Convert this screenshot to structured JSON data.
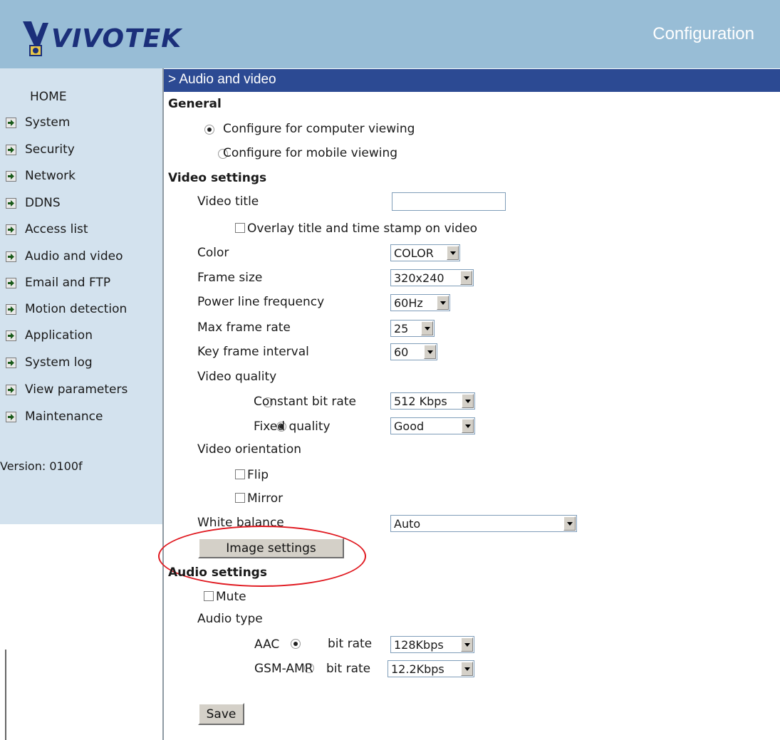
{
  "header": {
    "logo_text": "VIVOTEK",
    "title": "Configuration"
  },
  "breadcrumb": "> Audio and video",
  "sidebar": {
    "home": "HOME",
    "items": [
      {
        "label": "System"
      },
      {
        "label": "Security"
      },
      {
        "label": "Network"
      },
      {
        "label": "DDNS"
      },
      {
        "label": "Access list"
      },
      {
        "label": "Audio and video"
      },
      {
        "label": "Email and FTP"
      },
      {
        "label": "Motion detection"
      },
      {
        "label": "Application"
      },
      {
        "label": "System log"
      },
      {
        "label": "View parameters"
      },
      {
        "label": "Maintenance"
      }
    ],
    "version": "Version: 0100f"
  },
  "general": {
    "heading": "General",
    "computer_viewing": "Configure for computer viewing",
    "mobile_viewing": "Configure for mobile viewing",
    "selected": "computer"
  },
  "video": {
    "heading": "Video settings",
    "title_label": "Video title",
    "title_value": "",
    "overlay_label": "Overlay title and time stamp on video",
    "color_label": "Color",
    "color_value": "COLOR",
    "frame_size_label": "Frame size",
    "frame_size_value": "320x240",
    "power_line_label": "Power line frequency",
    "power_line_value": "60Hz",
    "max_frame_rate_label": "Max frame rate",
    "max_frame_rate_value": "25",
    "key_frame_label": "Key frame interval",
    "key_frame_value": "60",
    "quality_label": "Video quality",
    "constant_bit_rate_label": "Constant bit rate",
    "constant_bit_rate_value": "512 Kbps",
    "fixed_quality_label": "Fixed quality",
    "fixed_quality_value": "Good",
    "quality_selected": "fixed",
    "orientation_label": "Video orientation",
    "flip_label": "Flip",
    "mirror_label": "Mirror",
    "white_balance_label": "White balance",
    "white_balance_value": "Auto",
    "image_settings_button": "Image settings"
  },
  "audio": {
    "heading": "Audio settings",
    "mute_label": "Mute",
    "type_label": "Audio type",
    "aac_label": "AAC",
    "aac_bitrate_label": "bit rate",
    "aac_bitrate_value": "128Kbps",
    "gsm_label": "GSM-AMR",
    "gsm_bitrate_label": "bit rate",
    "gsm_bitrate_value": "12.2Kbps",
    "selected": "aac"
  },
  "save_button": "Save",
  "colors": {
    "header": "#98bdd6",
    "sidebar": "#d3e2ee",
    "breadcrumb_bar": "#2c4a93",
    "logo": "#1b2f7a",
    "annotation": "#e0181f"
  }
}
